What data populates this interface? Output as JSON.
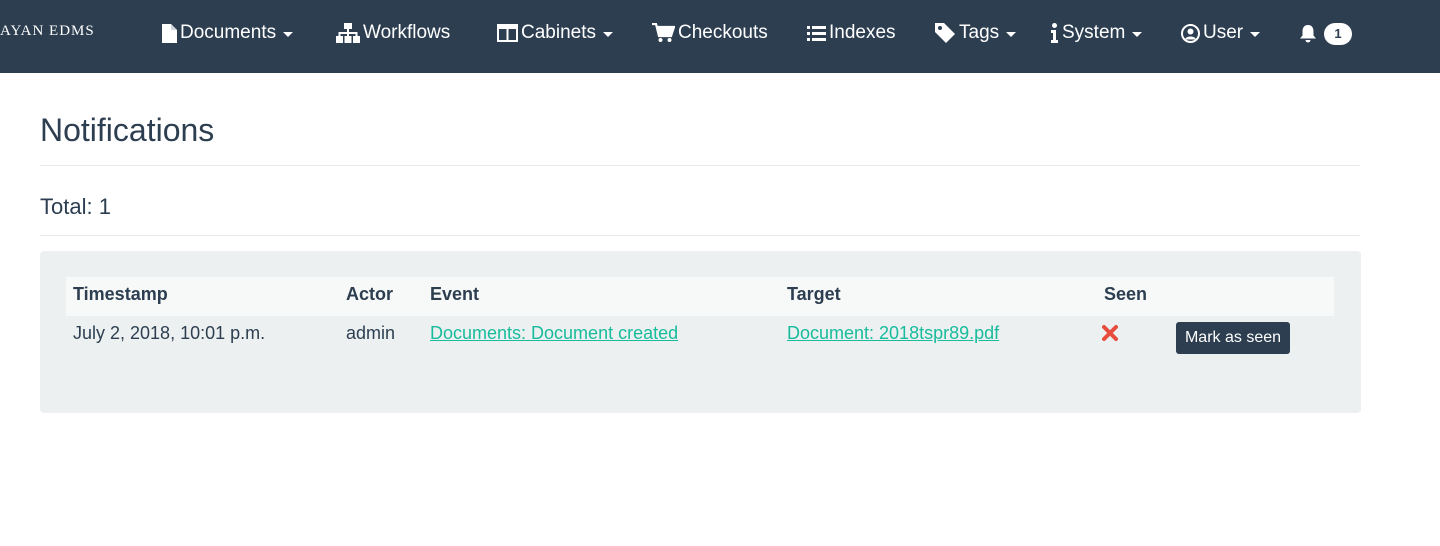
{
  "brand": {
    "name": "AYAN EDMS"
  },
  "nav": {
    "documents": "Documents",
    "workflows": "Workflows",
    "cabinets": "Cabinets",
    "checkouts": "Checkouts",
    "indexes": "Indexes",
    "tags": "Tags",
    "system": "System",
    "user": "User",
    "notifications_count": "1"
  },
  "page": {
    "title": "Notifications",
    "total": "Total: 1"
  },
  "table": {
    "headers": {
      "timestamp": "Timestamp",
      "actor": "Actor",
      "event": "Event",
      "target": "Target",
      "seen": "Seen"
    },
    "rows": [
      {
        "timestamp": "July 2, 2018, 10:01 p.m.",
        "actor": "admin",
        "event": "Documents: Document created",
        "target": "Document: 2018tspr89.pdf",
        "seen_icon": "red-x-icon",
        "action": "Mark as seen"
      }
    ]
  },
  "colors": {
    "navbar": "#2c3e50",
    "link": "#18bc9c",
    "not_seen": "#e74c3c",
    "well": "#ecf0f1"
  }
}
